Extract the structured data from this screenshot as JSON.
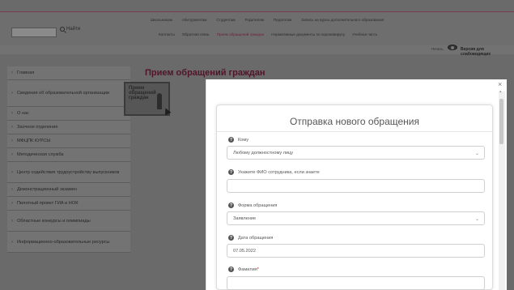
{
  "search": {
    "placeholder": "",
    "button_label": "Найти"
  },
  "topnav": [
    "Школьникам",
    "Абитуриентам",
    "Студентам",
    "Родителям",
    "Педагогам",
    "Запись на курсы дополнительного образования"
  ],
  "subnav": [
    "Контакты",
    "Обратная связь",
    "Прием обращений граждан",
    "Нормативные документы по коронавирусу",
    "Учебная часть"
  ],
  "header_bar": {
    "print": "Печать",
    "accessible": "Версия для слабовидящих"
  },
  "sidebar": {
    "items": [
      {
        "label": "Главная"
      },
      {
        "label": "Сведения об образовательной организации"
      },
      {
        "label": "О нас"
      },
      {
        "label": "Заочное отделение"
      },
      {
        "label": "МФЦПК КУРСЫ"
      },
      {
        "label": "Методическая служба"
      },
      {
        "label": "Центр содействия трудоустройству выпускников"
      },
      {
        "label": "Демонстрационный экзамен"
      },
      {
        "label": "Пилотный проект ГИА и НОК"
      },
      {
        "label": "Областные конкурсы и олимпиады"
      },
      {
        "label": "Информационно-образовательные ресурсы"
      }
    ]
  },
  "page_title": "Прием обращений граждан",
  "banner": {
    "text": "Прием обращений граждан"
  },
  "modal": {
    "close": "×",
    "form_title": "Отправка нового обращения",
    "fields": {
      "to": {
        "label": "Кому",
        "value": "Любому должностному лицу"
      },
      "employee": {
        "label": "Укажите ФИО сотрудника, если знаете",
        "value": ""
      },
      "form_type": {
        "label": "Форма обращения",
        "value": "Заявление"
      },
      "date": {
        "label": "Дата обращения",
        "value": "07.05.2022"
      },
      "surname": {
        "label": "Фамилия",
        "required_mark": "*",
        "value": ""
      }
    }
  }
}
